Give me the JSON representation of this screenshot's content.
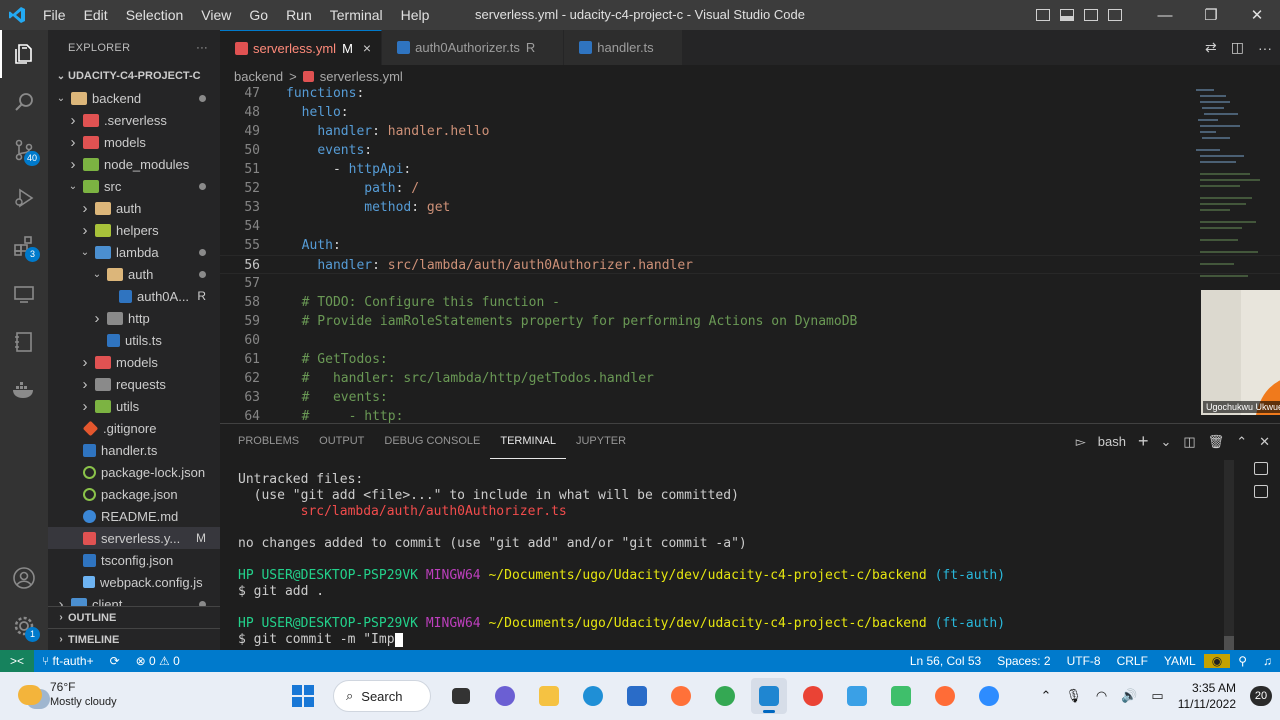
{
  "titlebar": {
    "menu": [
      "File",
      "Edit",
      "Selection",
      "View",
      "Go",
      "Run",
      "Terminal",
      "Help"
    ],
    "title": "serverless.yml - udacity-c4-project-c - Visual Studio Code",
    "controls": {
      "minimize": "—",
      "restore": "❐",
      "close": "✕"
    }
  },
  "activity": {
    "items": [
      {
        "name": "explorer-icon"
      },
      {
        "name": "search-icon"
      },
      {
        "name": "source-control-icon",
        "badge": "40"
      },
      {
        "name": "run-debug-icon"
      },
      {
        "name": "extensions-icon",
        "badge": "3"
      },
      {
        "name": "remote-explorer-icon"
      },
      {
        "name": "notebook-icon"
      },
      {
        "name": "docker-icon"
      }
    ],
    "bottom": [
      {
        "name": "account-icon"
      },
      {
        "name": "settings-gear-icon",
        "badge": "1"
      }
    ]
  },
  "sidebar": {
    "header": "EXPLORER",
    "more": "···",
    "project": "UDACITY-C4-PROJECT-C",
    "tree": [
      {
        "label": "backend",
        "depth": 1,
        "chev": "v",
        "icon": "folder",
        "dot": true
      },
      {
        "label": ".serverless",
        "depth": 2,
        "chev": ">",
        "icon": "fold-red"
      },
      {
        "label": "models",
        "depth": 2,
        "chev": ">",
        "icon": "fold-red"
      },
      {
        "label": "node_modules",
        "depth": 2,
        "chev": ">",
        "icon": "fold-green"
      },
      {
        "label": "src",
        "depth": 2,
        "chev": "v",
        "icon": "fold-green",
        "dot": true
      },
      {
        "label": "auth",
        "depth": 3,
        "chev": ">",
        "icon": "folder"
      },
      {
        "label": "helpers",
        "depth": 3,
        "chev": ">",
        "icon": "fold-lime"
      },
      {
        "label": "lambda",
        "depth": 3,
        "chev": "v",
        "icon": "fold-blue",
        "dot": true
      },
      {
        "label": "auth",
        "depth": 4,
        "chev": "v",
        "icon": "folder",
        "dot": true
      },
      {
        "label": "auth0A...",
        "depth": 5,
        "chev": "",
        "icon": "ts",
        "tag": "R"
      },
      {
        "label": "http",
        "depth": 4,
        "chev": ">",
        "icon": "fold-grey"
      },
      {
        "label": "utils.ts",
        "depth": 4,
        "chev": "",
        "icon": "ts"
      },
      {
        "label": "models",
        "depth": 3,
        "chev": ">",
        "icon": "fold-red"
      },
      {
        "label": "requests",
        "depth": 3,
        "chev": ">",
        "icon": "fold-grey"
      },
      {
        "label": "utils",
        "depth": 3,
        "chev": ">",
        "icon": "fold-green"
      },
      {
        "label": ".gitignore",
        "depth": 2,
        "chev": "",
        "icon": "git"
      },
      {
        "label": "handler.ts",
        "depth": 2,
        "chev": "",
        "icon": "ts"
      },
      {
        "label": "package-lock.json",
        "depth": 2,
        "chev": "",
        "icon": "json"
      },
      {
        "label": "package.json",
        "depth": 2,
        "chev": "",
        "icon": "json"
      },
      {
        "label": "README.md",
        "depth": 2,
        "chev": "",
        "icon": "info"
      },
      {
        "label": "serverless.y...",
        "depth": 2,
        "chev": "",
        "icon": "yml",
        "tag": "M",
        "selected": true
      },
      {
        "label": "tsconfig.json",
        "depth": 2,
        "chev": "",
        "icon": "ts"
      },
      {
        "label": "webpack.config.js",
        "depth": 2,
        "chev": "",
        "icon": "cube"
      },
      {
        "label": "client",
        "depth": 1,
        "chev": ">",
        "icon": "fold-blue",
        "dot": true
      }
    ],
    "outline": "OUTLINE",
    "timeline": "TIMELINE"
  },
  "tabs": [
    {
      "label": "serverless.yml",
      "mark": "M",
      "icon": "yml",
      "active": true,
      "close": "×"
    },
    {
      "label": "auth0Authorizer.ts",
      "mark": "R",
      "icon": "ts",
      "active": false
    },
    {
      "label": "handler.ts",
      "mark": "",
      "icon": "ts",
      "active": false
    }
  ],
  "breadcrumb": {
    "folder": "backend",
    "sep": ">",
    "file": "serverless.yml"
  },
  "editor": {
    "current_line": 56,
    "lines": [
      {
        "n": "47",
        "tokens": [
          [
            "k",
            "functions"
          ],
          [
            "p",
            ":"
          ]
        ]
      },
      {
        "n": "48",
        "tokens": [
          [
            "p",
            "  "
          ],
          [
            "k",
            "hello"
          ],
          [
            "p",
            ":"
          ]
        ]
      },
      {
        "n": "49",
        "tokens": [
          [
            "p",
            "    "
          ],
          [
            "k",
            "handler"
          ],
          [
            "p",
            ": "
          ],
          [
            "s",
            "handler.hello"
          ]
        ]
      },
      {
        "n": "50",
        "tokens": [
          [
            "p",
            "    "
          ],
          [
            "k",
            "events"
          ],
          [
            "p",
            ":"
          ]
        ]
      },
      {
        "n": "51",
        "tokens": [
          [
            "p",
            "      - "
          ],
          [
            "k",
            "httpApi"
          ],
          [
            "p",
            ":"
          ]
        ]
      },
      {
        "n": "52",
        "tokens": [
          [
            "p",
            "          "
          ],
          [
            "k",
            "path"
          ],
          [
            "p",
            ": "
          ],
          [
            "s",
            "/"
          ]
        ]
      },
      {
        "n": "53",
        "tokens": [
          [
            "p",
            "          "
          ],
          [
            "k",
            "method"
          ],
          [
            "p",
            ": "
          ],
          [
            "s",
            "get"
          ]
        ]
      },
      {
        "n": "54",
        "tokens": []
      },
      {
        "n": "55",
        "tokens": [
          [
            "p",
            "  "
          ],
          [
            "k",
            "Auth"
          ],
          [
            "p",
            ":"
          ]
        ]
      },
      {
        "n": "56",
        "tokens": [
          [
            "p",
            "    "
          ],
          [
            "k",
            "handler"
          ],
          [
            "p",
            ": "
          ],
          [
            "s",
            "src/lambda/auth/auth0Authorizer.handler"
          ]
        ]
      },
      {
        "n": "57",
        "tokens": []
      },
      {
        "n": "58",
        "tokens": [
          [
            "c",
            "  # TODO: Configure this function -"
          ]
        ]
      },
      {
        "n": "59",
        "tokens": [
          [
            "c",
            "  # Provide iamRoleStatements property for performing Actions on DynamoDB"
          ]
        ]
      },
      {
        "n": "60",
        "tokens": []
      },
      {
        "n": "61",
        "tokens": [
          [
            "c",
            "  # GetTodos:"
          ]
        ]
      },
      {
        "n": "62",
        "tokens": [
          [
            "c",
            "  #   handler: src/lambda/http/getTodos.handler"
          ]
        ]
      },
      {
        "n": "63",
        "tokens": [
          [
            "c",
            "  #   events:"
          ]
        ]
      },
      {
        "n": "64",
        "tokens": [
          [
            "c",
            "  #     - http:"
          ]
        ]
      }
    ]
  },
  "webcam": {
    "name": "Ugochukwu Ukwuegbu"
  },
  "panel": {
    "tabs": [
      "PROBLEMS",
      "OUTPUT",
      "DEBUG CONSOLE",
      "TERMINAL",
      "JUPYTER"
    ],
    "active_tab": "TERMINAL",
    "shell": "bash",
    "plus": "+",
    "terminal_lines": [
      [
        [
          "",
          "Untracked files:"
        ]
      ],
      [
        [
          "",
          "  (use \"git add <file>...\" to include in what will be committed)"
        ]
      ],
      [
        [
          "tr",
          "        src/lambda/auth/auth0Authorizer.ts"
        ]
      ],
      [
        [
          "",
          ""
        ]
      ],
      [
        [
          "",
          "no changes added to commit (use \"git add\" and/or \"git commit -a\")"
        ]
      ],
      [
        [
          "",
          ""
        ]
      ],
      [
        [
          "tg",
          "HP USER@DESKTOP-PSP29VK "
        ],
        [
          "tm",
          "MINGW64 "
        ],
        [
          "ty",
          "~/Documents/ugo/Udacity/dev/udacity-c4-project-c/backend "
        ],
        [
          "tc",
          "(ft-auth)"
        ]
      ],
      [
        [
          "",
          "$ git add ."
        ]
      ],
      [
        [
          "",
          ""
        ]
      ],
      [
        [
          "tg",
          "HP USER@DESKTOP-PSP29VK "
        ],
        [
          "tm",
          "MINGW64 "
        ],
        [
          "ty",
          "~/Documents/ugo/Udacity/dev/udacity-c4-project-c/backend "
        ],
        [
          "tc",
          "(ft-auth)"
        ]
      ],
      [
        [
          "",
          "$ git commit -m \"Imp"
        ]
      ]
    ]
  },
  "statusbar": {
    "remote": "><",
    "branch": "ft-auth+",
    "sync": "⟳",
    "errors": "⊗ 0",
    "warnings": "⚠ 0",
    "right": [
      "Ln 56, Col 53",
      "Spaces: 2",
      "UTF-8",
      "CRLF",
      "YAML"
    ]
  },
  "taskbar": {
    "weather_temp": "76°F",
    "weather_desc": "Mostly cloudy",
    "search": "Search",
    "apps": [
      {
        "name": "file-explorer-icon",
        "color": "#f5c242"
      },
      {
        "name": "edge-icon",
        "color": "#1f8fd6"
      },
      {
        "name": "store-icon",
        "color": "#2a6cc8"
      },
      {
        "name": "firefox-icon",
        "color": "#ff7139"
      },
      {
        "name": "chrome-icon",
        "color": "#34a853"
      },
      {
        "name": "vscode-icon",
        "color": "#1f86d1",
        "active": true
      },
      {
        "name": "chrome-alt-icon",
        "color": "#ea4335"
      },
      {
        "name": "notepad-icon",
        "color": "#3aa0e6"
      },
      {
        "name": "gitkraken-icon",
        "color": "#3fbf6b"
      },
      {
        "name": "postman-icon",
        "color": "#ff6c37"
      },
      {
        "name": "zoom-icon",
        "color": "#2d8cff"
      }
    ],
    "time": "3:35 AM",
    "date": "11/11/2022",
    "notifications": "20"
  }
}
